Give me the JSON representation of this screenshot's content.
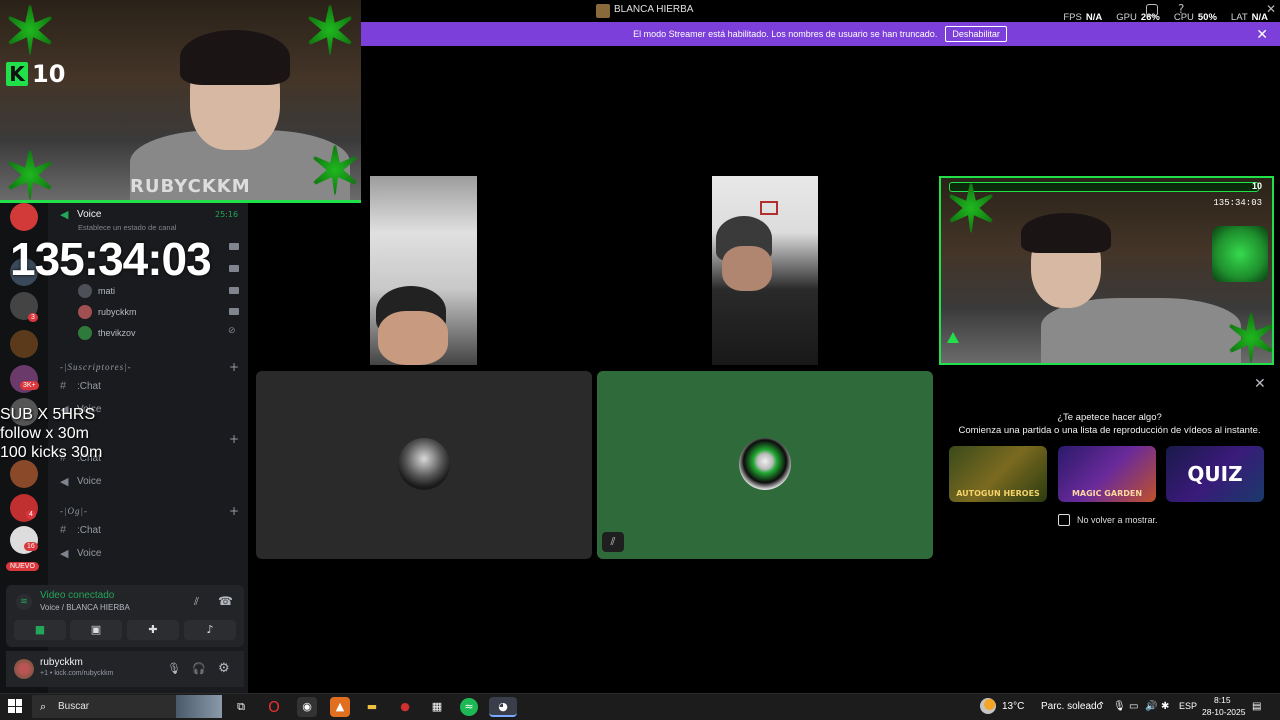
{
  "window": {
    "title": "BLANCA HIERBA"
  },
  "overlay_stats": [
    {
      "label": "FPS",
      "value": "N/A"
    },
    {
      "label": "GPU",
      "value": "26%"
    },
    {
      "label": "CPU",
      "value": "50%"
    },
    {
      "label": "LAT",
      "value": "N/A"
    }
  ],
  "banner": {
    "text": "El modo Streamer está habilitado. Los nombres de usuario se han truncado.",
    "button": "Deshabilitar",
    "close_icon": "close-icon"
  },
  "webcam": {
    "kick_count": "10",
    "name_overlay": "RUBYCKKM"
  },
  "stream_overlay": {
    "timer": "135:34:03",
    "goals": [
      "SUB X 5HRS",
      "follow x 30m",
      "100 kicks 30m"
    ]
  },
  "sidebar": {
    "guild_badges": [
      "3",
      "3K+",
      "4",
      "16"
    ],
    "nuevo_label": "NUEVO",
    "voice_channel": {
      "name": "Voice",
      "time": "25:16",
      "status": "Establece un estado de canal"
    },
    "members": [
      "mati",
      "rubyckkm",
      "thevikzov"
    ],
    "categories": [
      {
        "name": "-|Suscriptores|-",
        "channels": [
          ":Chat",
          "Voice"
        ]
      },
      {
        "name": "-|Og|-",
        "channels": [
          ":Chat",
          "Voice"
        ]
      }
    ],
    "hidden_channel": {
      "chat": ":Chat",
      "voice": "Voice"
    }
  },
  "voice_connected": {
    "title": "Video conectado",
    "subtitle": "Voice / BLANCA HIERBA"
  },
  "user": {
    "name": "rubyckkm",
    "status": "+1 • kick.com/rubyckkm"
  },
  "call": {
    "vid3_timer": "135:34:03",
    "vid3_kick": "10"
  },
  "activity": {
    "question": "¿Te apetece hacer algo?",
    "subtitle": "Comienza una partida o una lista de reproducción de vídeos al instante.",
    "cards": [
      "AUTOGUN HEROES",
      "MAGIC GARDEN",
      "QUIZ"
    ],
    "checkbox_label": "No volver a mostrar."
  },
  "taskbar": {
    "search_placeholder": "Buscar",
    "weather_temp": "13°C",
    "weather_desc": "Parc. soleado",
    "lang": "ESP",
    "time": "8:15",
    "date": "28-10-2025"
  },
  "colors": {
    "accent_green": "#21e04a",
    "streamer_purple": "#7c3fd9",
    "discord_green": "#23a55a"
  }
}
